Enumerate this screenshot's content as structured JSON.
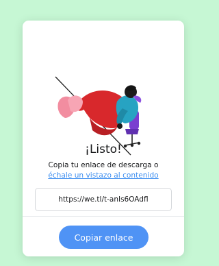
{
  "dialog": {
    "title": "¡Listo!",
    "subtitle_text": "Copia tu enlace de descarga o",
    "subtitle_link": "échale un vistazo al contenido",
    "url_value": "https://we.tl/t-anIs6OAdfl",
    "copy_button_label": "Copiar enlace"
  },
  "colors": {
    "background": "#c6f7d4",
    "card": "#ffffff",
    "accent": "#4f93f5",
    "link": "#3f8ff0"
  },
  "icons": {
    "illustration": "person-reclining-in-chair-illustration"
  }
}
